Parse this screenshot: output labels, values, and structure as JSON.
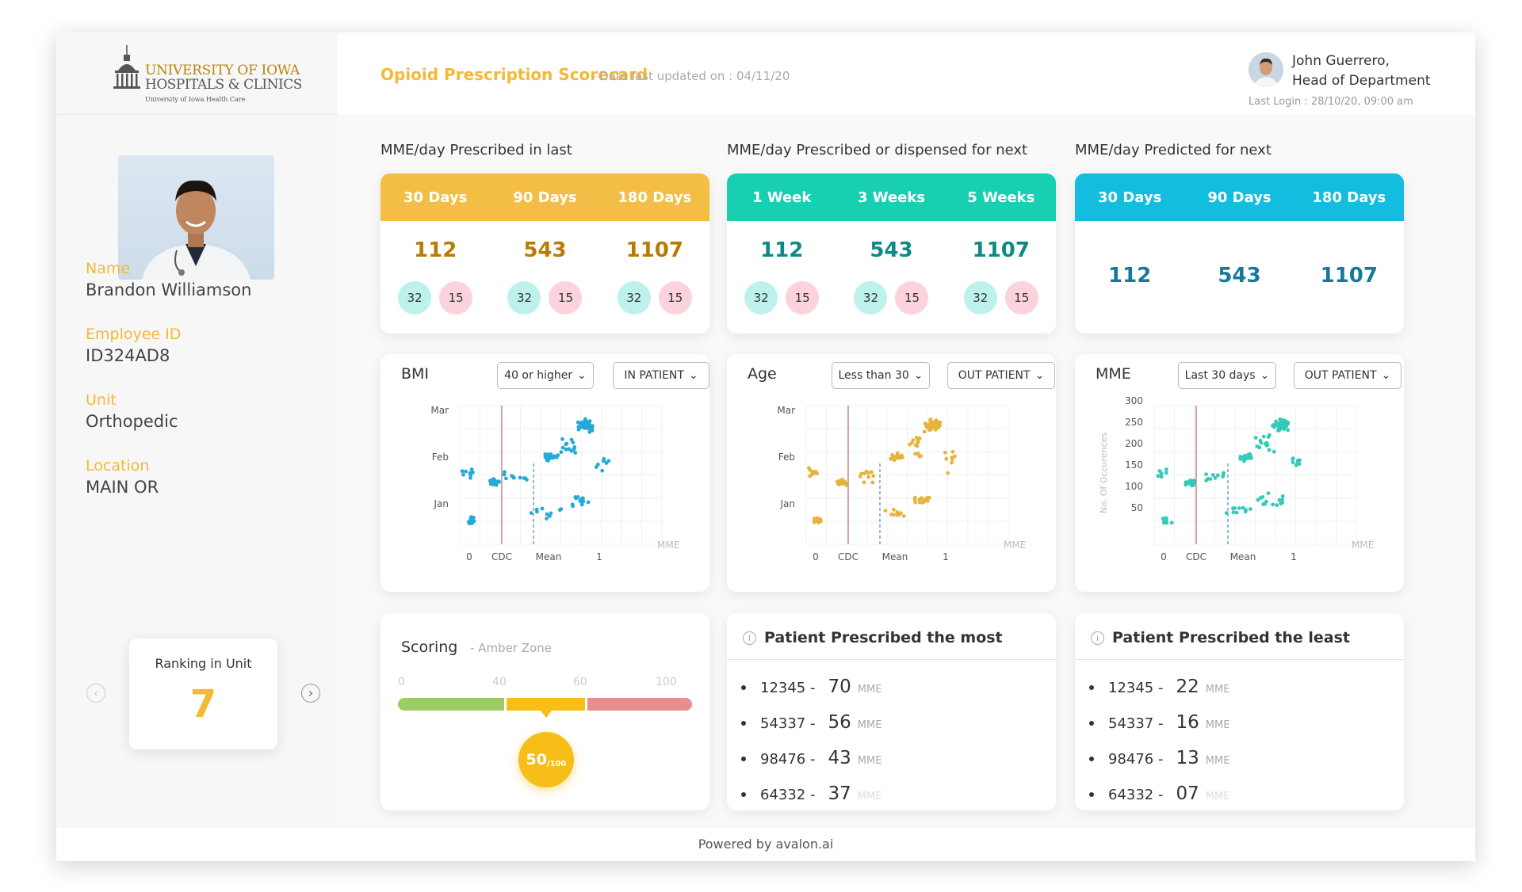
{
  "header": {
    "title": "Opioid Prescription Scorecard",
    "subtitle": "- Data last updated on : 04/11/20",
    "user_name_line1": "John Guerrero,",
    "user_name_line2": "Head of Department",
    "last_login": "Last Login : 28/10/20, 09:00 am"
  },
  "logo": {
    "line1": "UNIVERSITY OF IOWA",
    "line2": "HOSPITALS & CLINICS",
    "line3": "University of Iowa Health Care"
  },
  "profile": {
    "name_label": "Name",
    "name": "Brandon Williamson",
    "employee_id_label": "Employee ID",
    "employee_id": "ID324AD8",
    "unit_label": "Unit",
    "unit": "Orthopedic",
    "location_label": "Location",
    "location": "MAIN OR",
    "ranking_label": "Ranking in Unit",
    "ranking_value": "7"
  },
  "summary": [
    {
      "title": "MME/day Prescribed in last",
      "color": "#f3bd46",
      "text_color": "#b87c05",
      "headers": [
        "30 Days",
        "90 Days",
        "180 Days"
      ],
      "values": [
        "112",
        "543",
        "1107"
      ],
      "pills": [
        [
          "32",
          "15"
        ],
        [
          "32",
          "15"
        ],
        [
          "32",
          "15"
        ]
      ]
    },
    {
      "title": "MME/day Prescribed or dispensed for next",
      "color": "#19cfb1",
      "text_color": "#0e8a85",
      "headers": [
        "1 Week",
        "3 Weeks",
        "5 Weeks"
      ],
      "values": [
        "112",
        "543",
        "1107"
      ],
      "pills": [
        [
          "32",
          "15"
        ],
        [
          "32",
          "15"
        ],
        [
          "32",
          "15"
        ]
      ]
    },
    {
      "title": "MME/day Predicted for next",
      "color": "#12bde0",
      "text_color": "#16789c",
      "headers": [
        "30 Days",
        "90 Days",
        "180 Days"
      ],
      "values": [
        "112",
        "543",
        "1107"
      ],
      "pills": []
    }
  ],
  "charts": {
    "bmi": {
      "title": "BMI",
      "filter1": "40 or higher",
      "filter2": "IN PATIENT",
      "color": "#27a9d8"
    },
    "age": {
      "title": "Age",
      "filter1": "Less than 30",
      "filter2": "OUT PATIENT",
      "color": "#e6b33c"
    },
    "mme": {
      "title": "MME",
      "filter1": "Last 30 days",
      "filter2": "OUT PATIENT",
      "color": "#33cbb8"
    },
    "common": {
      "y_ticks_month": [
        "Mar",
        "Feb",
        "Jan"
      ],
      "y_ticks_num": [
        "300",
        "250",
        "200",
        "150",
        "100",
        "50"
      ],
      "y_axis_label": "No. Of Occurences",
      "x_ticks": [
        "0",
        "CDC",
        "Mean",
        "1"
      ],
      "x_unit": "MME"
    }
  },
  "chart_data": [
    {
      "type": "scatter",
      "title": "BMI",
      "xlabel": "MME",
      "x_ticks": [
        "0",
        "CDC",
        "Mean",
        "1"
      ],
      "y_ticks": [
        "Jan",
        "Feb",
        "Mar"
      ],
      "reference_lines": [
        "CDC",
        "Mean"
      ]
    },
    {
      "type": "scatter",
      "title": "Age",
      "xlabel": "MME",
      "x_ticks": [
        "0",
        "CDC",
        "Mean",
        "1"
      ],
      "y_ticks": [
        "Jan",
        "Feb",
        "Mar"
      ],
      "reference_lines": [
        "CDC",
        "Mean"
      ]
    },
    {
      "type": "scatter",
      "title": "MME",
      "xlabel": "MME",
      "ylabel": "No. Of Occurences",
      "x_ticks": [
        "0",
        "CDC",
        "Mean",
        "1"
      ],
      "y_ticks": [
        "50",
        "100",
        "150",
        "200",
        "250",
        "300"
      ],
      "ylim": [
        25,
        325
      ],
      "reference_lines": [
        "CDC",
        "Mean"
      ]
    }
  ],
  "scoring": {
    "title": "Scoring",
    "zone": "- Amber Zone",
    "ticks": [
      "0",
      "40",
      "60",
      "100"
    ],
    "score": "50",
    "score_max": "/100",
    "score_value": 50,
    "zone_colors": [
      "#9acd65",
      "#f7bd18",
      "#e78f8f"
    ]
  },
  "most": {
    "title": "Patient Prescribed the most",
    "items": [
      {
        "id": "12345 -",
        "value": "70",
        "unit": "MME"
      },
      {
        "id": "54337 -",
        "value": "56",
        "unit": "MME"
      },
      {
        "id": "98476 -",
        "value": "43",
        "unit": "MME"
      },
      {
        "id": "64332 -",
        "value": "37",
        "unit": "MME"
      }
    ]
  },
  "least": {
    "title": "Patient Prescribed the least",
    "items": [
      {
        "id": "12345 -",
        "value": "22",
        "unit": "MME"
      },
      {
        "id": "54337 -",
        "value": "16",
        "unit": "MME"
      },
      {
        "id": "98476 -",
        "value": "13",
        "unit": "MME"
      },
      {
        "id": "64332 -",
        "value": "07",
        "unit": "MME"
      }
    ]
  },
  "footer": {
    "text": "Powered by avalon.ai"
  }
}
